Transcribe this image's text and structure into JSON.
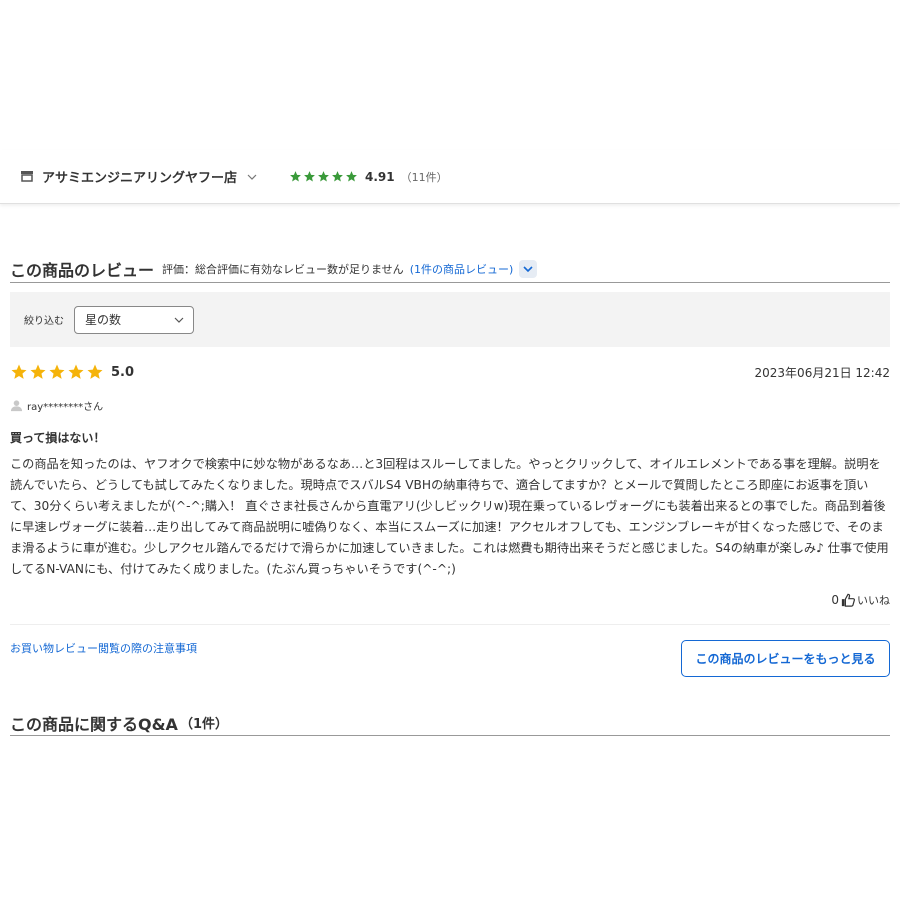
{
  "store": {
    "name": "アサミエンジニアリングヤフー店",
    "rating": "4.91",
    "review_count": "（11件）",
    "star_color": "#3a9a3a",
    "stars_filled": 5
  },
  "reviews_section": {
    "title": "この商品のレビュー",
    "note": "評価：総合評価に有効なレビュー数が足りません",
    "link": "(1件の商品レビュー)",
    "filter": {
      "label": "絞り込む",
      "selected": "星の数"
    }
  },
  "review": {
    "stars_filled": 5,
    "star_color": "#f5b30a",
    "rating": "5.0",
    "date": "2023年06月21日 12:42",
    "reviewer": "ray********さん",
    "headline": "買って損はない！",
    "body": "この商品を知ったのは、ヤフオクで検索中に妙な物があるなあ…と3回程はスルーしてました。やっとクリックして、オイルエレメントである事を理解。説明を読んでいたら、どうしても試してみたくなりました。現時点でスバルS4 VBHの納車待ちで、適合してますか？とメールで質問したところ即座にお返事を頂いて、30分くらい考えましたが(^-^;購入！ 直ぐさま社長さんから直電アリ(少しビックリw)現在乗っているレヴォーグにも装着出来るとの事でした。商品到着後に早速レヴォーグに装着…走り出してみて商品説明に嘘偽りなく、本当にスムーズに加速！アクセルオフしても、エンジンブレーキが甘くなった感じで、そのまま滑るように車が進む。少しアクセル踏んでるだけで滑らかに加速していきました。これは燃費も期待出来そうだと感じました。S4の納車が楽しみ♪ 仕事で使用してるN-VANにも、付けてみたく成りました。(たぶん買っちゃいそうです(^-^;)",
    "like_count": "0",
    "like_label": "いいね"
  },
  "footer": {
    "notice_link": "お買い物レビュー閲覧の際の注意事項",
    "more_button": "この商品のレビューをもっと見る"
  },
  "qa": {
    "title": "この商品に関するQ&A",
    "count": "（1件）"
  },
  "colors": {
    "link": "#1468d4",
    "text": "#333333"
  }
}
